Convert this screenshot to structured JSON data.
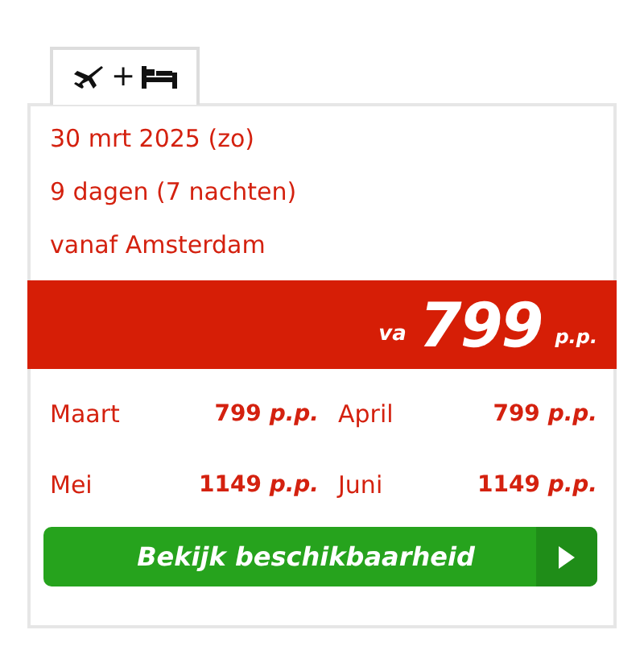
{
  "tab": {
    "separator": "+",
    "selected": true
  },
  "details": [
    "30 mrt 2025 (zo)",
    "9 dagen (7 nachten)",
    "vanaf Amsterdam"
  ],
  "price_banner": {
    "prefix": "va",
    "amount": "799",
    "suffix": "p.p."
  },
  "months": [
    {
      "name": "Maart",
      "price": "799 *p.p.*"
    },
    {
      "name": "April",
      "price": "799 *p.p.*"
    },
    {
      "name": "Mei",
      "price": "1149 *p.p.*"
    },
    {
      "name": "Juni",
      "price": "1149 *p.p.*"
    }
  ],
  "button": {
    "label": "Bekijk beschikbaarheid"
  }
}
